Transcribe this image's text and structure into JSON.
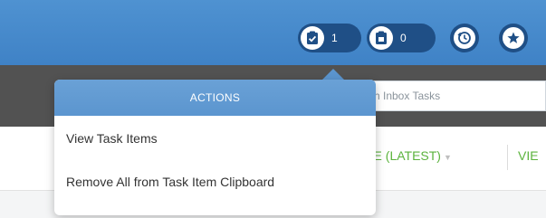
{
  "header": {
    "task_count": "1",
    "clipboard_count": "0",
    "icons": [
      "task-checklist-icon",
      "clipboard-icon",
      "history-icon",
      "star-icon"
    ],
    "colors": {
      "bar": "#4388c9",
      "pill": "#1f4f86"
    }
  },
  "search": {
    "placeholder": "rch Inbox Tasks"
  },
  "sort": {
    "label": "TE (LATEST)",
    "view_label": "VIE",
    "color": "#5bb33d"
  },
  "actions_menu": {
    "title": "ACTIONS",
    "items": [
      {
        "label": "View Task Items"
      },
      {
        "label": "Remove All from Task Item Clipboard"
      }
    ]
  }
}
